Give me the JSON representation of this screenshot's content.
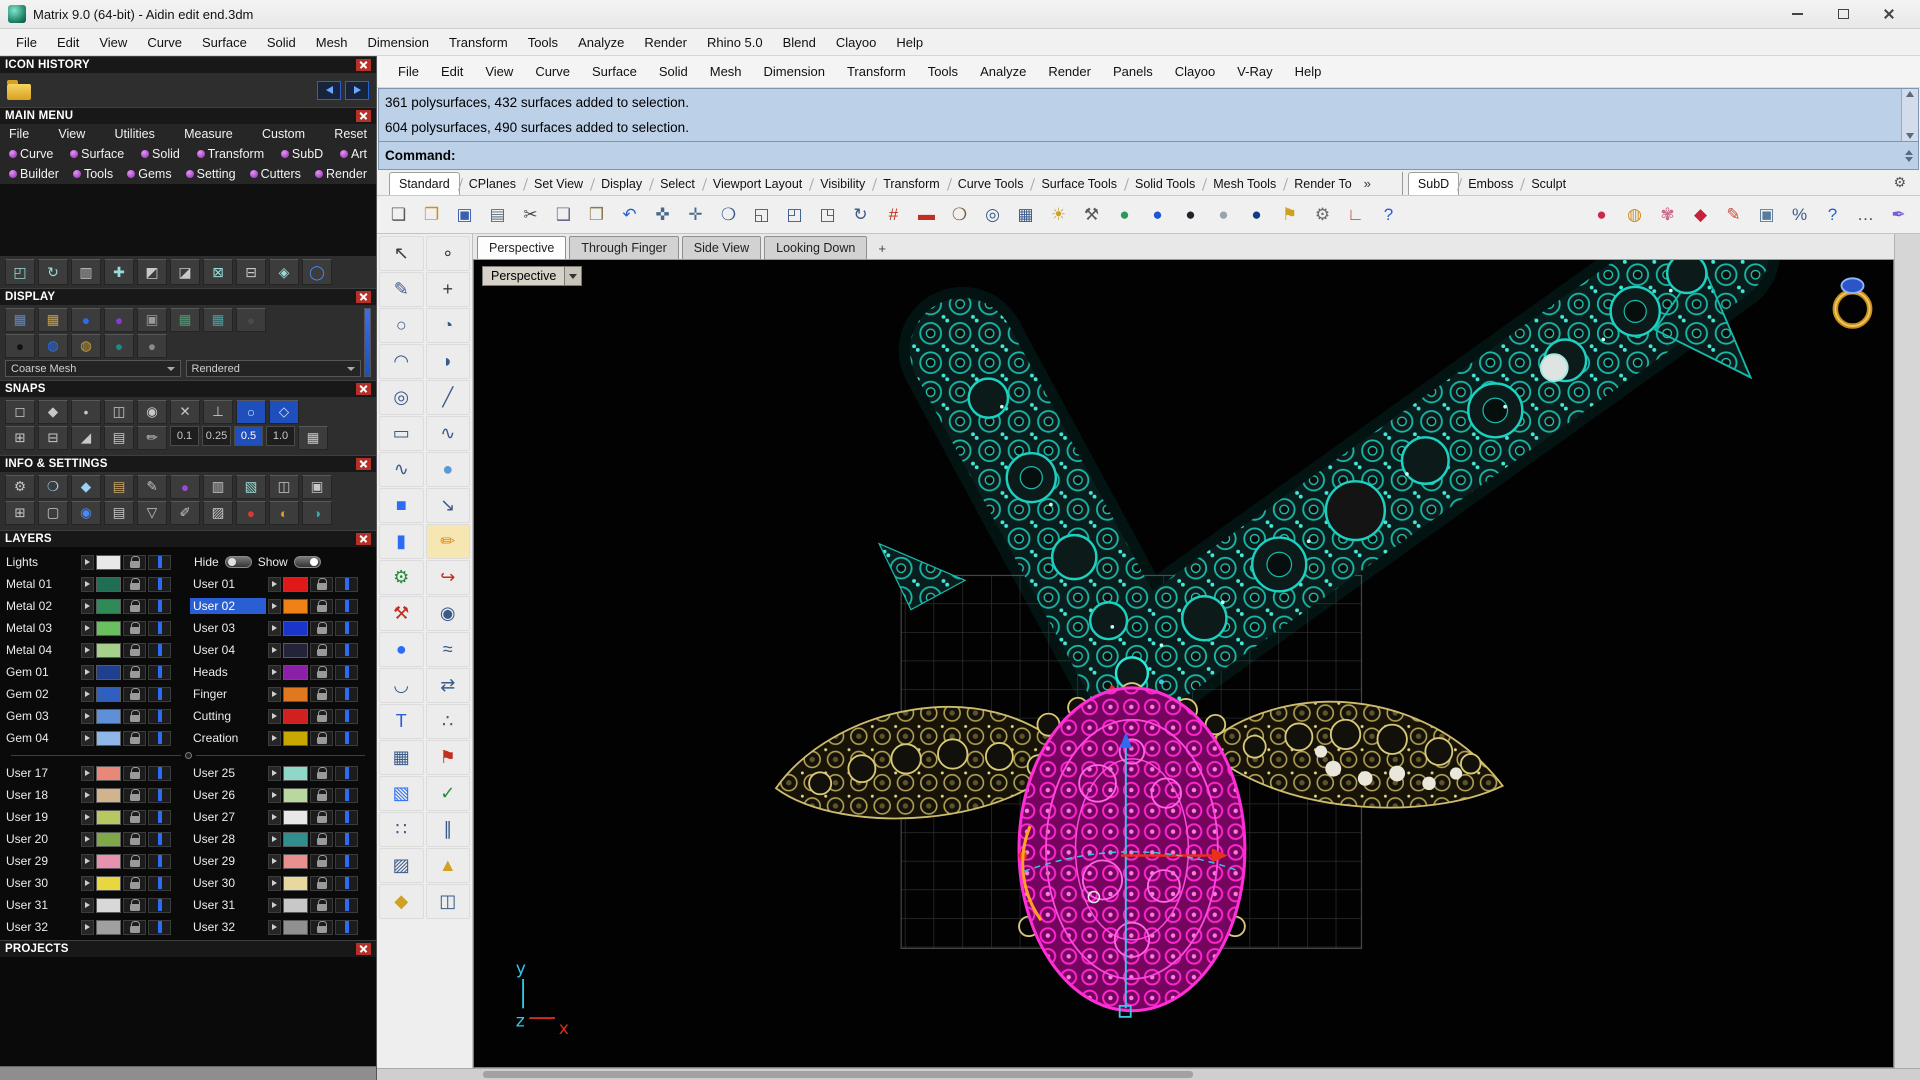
{
  "window": {
    "title": "Matrix 9.0 (64-bit) - Aidin edit end.3dm"
  },
  "app_menu": {
    "items": [
      "File",
      "Edit",
      "View",
      "Curve",
      "Surface",
      "Solid",
      "Mesh",
      "Dimension",
      "Transform",
      "Tools",
      "Analyze",
      "Render",
      "Rhino 5.0",
      "Blend",
      "Clayoo",
      "Help"
    ]
  },
  "sidebar": {
    "icon_history": {
      "title": "ICON HISTORY"
    },
    "main_menu": {
      "title": "MAIN MENU",
      "row1": [
        "File",
        "View",
        "Utilities",
        "Measure",
        "Custom",
        "Reset"
      ],
      "row2": [
        "Curve",
        "Surface",
        "Solid",
        "Transform",
        "SubD",
        "Art"
      ],
      "row3": [
        "Builder",
        "Tools",
        "Gems",
        "Setting",
        "Cutters",
        "Render"
      ]
    },
    "transform_row": {
      "icons": [
        {
          "n": "gumball-icon",
          "g": "◰",
          "c": "#9adcd8"
        },
        {
          "n": "rotate-icon",
          "g": "↻",
          "c": "#9adcd8"
        },
        {
          "n": "columns-icon",
          "g": "▥",
          "c": "#c8c8c8"
        },
        {
          "n": "move-icon",
          "g": "✚",
          "c": "#9adcd8"
        },
        {
          "n": "align-icon",
          "g": "◩",
          "c": "#c8c8c8"
        },
        {
          "n": "orient-icon",
          "g": "◪",
          "c": "#c8c8c8"
        },
        {
          "n": "boolean-icon",
          "g": "⊠",
          "c": "#9adcd8"
        },
        {
          "n": "split-icon",
          "g": "⊟",
          "c": "#c8c8c8"
        },
        {
          "n": "merge-icon",
          "g": "◈",
          "c": "#9adcd8"
        },
        {
          "n": "blue-ring-icon",
          "g": "◯",
          "c": "#4a8af4"
        }
      ]
    },
    "display": {
      "title": "DISPLAY",
      "mesh_dropdown": "Coarse Mesh",
      "mode_dropdown": "Rendered",
      "icons1": [
        {
          "n": "wireframe-mode-icon",
          "g": "▦",
          "c": "#5a8ad4"
        },
        {
          "n": "shaded-mode-icon",
          "g": "▦",
          "c": "#d0a030"
        },
        {
          "n": "rendered-mode-icon",
          "g": "●",
          "c": "#2a6df4"
        },
        {
          "n": "raytraced-mode-icon",
          "g": "●",
          "c": "#8a3ad4"
        },
        {
          "n": "monitor-mode-icon",
          "g": "▣",
          "c": "#9a9a9a"
        },
        {
          "n": "grid-green-icon",
          "g": "▦",
          "c": "#3aa86a"
        },
        {
          "n": "grid-teal-icon",
          "g": "▦",
          "c": "#3aa8a8"
        },
        {
          "n": "dark-mode-icon",
          "g": "●",
          "c": "#4a4a4a"
        }
      ],
      "icons2": [
        {
          "n": "black-sphere-icon",
          "g": "●",
          "c": "#111111"
        },
        {
          "n": "ring-blue-icon",
          "g": "◍",
          "c": "#2a6df4"
        },
        {
          "n": "ring-gold-icon",
          "g": "◍",
          "c": "#d0a030"
        },
        {
          "n": "sphere-teal-icon",
          "g": "●",
          "c": "#1a8a8a"
        },
        {
          "n": "sphere-gray-icon",
          "g": "●",
          "c": "#8a8a8a"
        }
      ]
    },
    "snaps": {
      "title": "SNAPS",
      "icons1": [
        {
          "n": "snap-end-icon",
          "g": "◻",
          "c": "#c8c8c8"
        },
        {
          "n": "snap-near-icon",
          "g": "◆",
          "c": "#c8c8c8"
        },
        {
          "n": "snap-point-icon",
          "g": "•",
          "c": "#c8c8c8"
        },
        {
          "n": "snap-mid-icon",
          "g": "◫",
          "c": "#c8c8c8"
        },
        {
          "n": "snap-cen-icon",
          "g": "◉",
          "c": "#c8c8c8"
        },
        {
          "n": "snap-int-icon",
          "g": "✕",
          "c": "#c8c8c8"
        },
        {
          "n": "snap-perp-icon",
          "g": "⊥",
          "c": "#c8c8c8"
        },
        {
          "n": "snap-tan-icon",
          "g": "○",
          "c": "#cfe4ff",
          "b": "#1e4fbc"
        },
        {
          "n": "snap-quad-icon",
          "g": "◇",
          "c": "#cfe4ff",
          "b": "#1e4fbc"
        }
      ],
      "icons2": [
        {
          "n": "grid-snap-toggle-icon",
          "g": "⊞",
          "c": "#c8c8c8"
        },
        {
          "n": "ortho-toggle-icon",
          "g": "⊟",
          "c": "#c8c8c8"
        },
        {
          "n": "planar-toggle-icon",
          "g": "◢",
          "c": "#c8c8c8"
        },
        {
          "n": "osnap-panel-icon",
          "g": "▤",
          "c": "#c8c8c8"
        },
        {
          "n": "smarttrack-icon",
          "g": "✏",
          "c": "#c8c8c8"
        }
      ],
      "increments": [
        {
          "v": "0.1"
        },
        {
          "v": "0.25"
        },
        {
          "v": "0.5",
          "bg": "#1e4fbc",
          "fg": "#ffffff"
        },
        {
          "v": "1.0"
        }
      ],
      "trailing_icon": {
        "g": "▦"
      }
    },
    "info_settings": {
      "title": "INFO & SETTINGS",
      "icons1": [
        {
          "n": "gear-icon",
          "g": "⚙",
          "c": "#c8c8c8"
        },
        {
          "n": "search-icon",
          "g": "❍",
          "c": "#9ad4f4"
        },
        {
          "n": "gem-info-icon",
          "g": "◆",
          "c": "#9ad4f4"
        },
        {
          "n": "notebook-icon",
          "g": "▤",
          "c": "#c8a868"
        },
        {
          "n": "edit-pen-icon",
          "g": "✎",
          "c": "#c8c8c8"
        },
        {
          "n": "purple-ball-icon",
          "g": "●",
          "c": "#9a4ad4"
        },
        {
          "n": "rows-info-icon",
          "g": "▥",
          "c": "#c8c8c8"
        },
        {
          "n": "texture-icon",
          "g": "▧",
          "c": "#9adcd8"
        },
        {
          "n": "columns-info-icon",
          "g": "◫",
          "c": "#c8c8c8"
        },
        {
          "n": "panel-info-icon",
          "g": "▣",
          "c": "#c8c8c8"
        }
      ],
      "icons2": [
        {
          "n": "table-icon",
          "g": "⊞",
          "c": "#c8c8c8"
        },
        {
          "n": "screen-icon",
          "g": "▢",
          "c": "#c8c8c8"
        },
        {
          "n": "globe-icon",
          "g": "◉",
          "c": "#4a8af4"
        },
        {
          "n": "document-icon",
          "g": "▤",
          "c": "#c8c8c8"
        },
        {
          "n": "funnel-icon",
          "g": "▽",
          "c": "#c8c8c8"
        },
        {
          "n": "annotate-icon",
          "g": "✐",
          "c": "#c8c8c8"
        },
        {
          "n": "hatch-info-icon",
          "g": "▨",
          "c": "#c8c8c8"
        },
        {
          "n": "red-ball-icon",
          "g": "●",
          "c": "#d43a3a"
        },
        {
          "n": "half-gold-icon",
          "g": "◐",
          "c": "#d0a030"
        },
        {
          "n": "half-teal-icon",
          "g": "◑",
          "c": "#3aa8a8"
        }
      ]
    },
    "layers": {
      "title": "LAYERS",
      "lights": {
        "name": "Lights",
        "hide_label": "Hide",
        "show_label": "Show",
        "swatch": "#e8e8e8"
      },
      "rows": [
        {
          "left": {
            "name": "Metal 01",
            "color": "#1f6e54"
          },
          "right": {
            "name": "User 01",
            "color": "#e01818"
          }
        },
        {
          "left": {
            "name": "Metal 02",
            "color": "#2e8b57"
          },
          "right": {
            "name": "User 02",
            "color": "#f08018",
            "bg": "#2a5fd4",
            "fg": "#ffffff"
          }
        },
        {
          "left": {
            "name": "Metal 03",
            "color": "#6abf5e"
          },
          "right": {
            "name": "User 03",
            "color": "#1a35cc"
          }
        },
        {
          "left": {
            "name": "Metal 04",
            "color": "#a8d08d"
          },
          "right": {
            "name": "User 04",
            "color": "#23233a"
          }
        },
        {
          "left": {
            "name": "Gem 01",
            "color": "#1f3f8f"
          },
          "right": {
            "name": "Heads",
            "color": "#8b1fa8"
          }
        },
        {
          "left": {
            "name": "Gem 02",
            "color": "#2f5fbf"
          },
          "right": {
            "name": "Finger",
            "color": "#e07820"
          }
        },
        {
          "left": {
            "name": "Gem 03",
            "color": "#5f8fd8"
          },
          "right": {
            "name": "Cutting",
            "color": "#d02020"
          }
        },
        {
          "left": {
            "name": "Gem 04",
            "color": "#8fb8e8"
          },
          "right": {
            "name": "Creation",
            "color": "#c8a800"
          }
        }
      ],
      "rows2": [
        {
          "left": {
            "name": "User 17",
            "color": "#e88878"
          },
          "right": {
            "name": "User 25",
            "color": "#8fd8c8"
          }
        },
        {
          "left": {
            "name": "User 18",
            "color": "#d2b48c"
          },
          "right": {
            "name": "User 26",
            "color": "#b8d8a0"
          }
        },
        {
          "left": {
            "name": "User 19",
            "color": "#b8c860"
          },
          "right": {
            "name": "User 27",
            "color": "#e8e8e8"
          }
        },
        {
          "left": {
            "name": "User 20",
            "color": "#7fa848"
          },
          "right": {
            "name": "User 28",
            "color": "#2f8f8f"
          }
        }
      ],
      "rows3": [
        {
          "left": {
            "name": "User 29",
            "color": "#e890b0"
          },
          "right": {
            "name": "User 29",
            "color": "#e89090"
          }
        },
        {
          "left": {
            "name": "User 30",
            "color": "#e8d840"
          },
          "right": {
            "name": "User 30",
            "color": "#e8d8a0"
          }
        },
        {
          "left": {
            "name": "User 31",
            "color": "#d8d8d8"
          },
          "right": {
            "name": "User 31",
            "color": "#c8c8c8"
          }
        },
        {
          "left": {
            "name": "User 32",
            "color": "#a0a0a0"
          },
          "right": {
            "name": "User 32",
            "color": "#909090"
          }
        }
      ]
    },
    "projects": {
      "title": "PROJECTS"
    }
  },
  "rhino": {
    "menu": [
      "File",
      "Edit",
      "View",
      "Curve",
      "Surface",
      "Solid",
      "Mesh",
      "Dimension",
      "Transform",
      "Tools",
      "Analyze",
      "Render",
      "Panels",
      "Clayoo",
      "V-Ray",
      "Help"
    ],
    "history_lines": [
      "361 polysurfaces, 432 surfaces added to selection.",
      "604 polysurfaces, 490 surfaces added to selection."
    ],
    "prompt": "Command:",
    "tabs": [
      "Standard",
      "CPlanes",
      "Set View",
      "Display",
      "Select",
      "Viewport Layout",
      "Visibility",
      "Transform",
      "Curve Tools",
      "Surface Tools",
      "Solid Tools",
      "Mesh Tools",
      "Render To"
    ],
    "overflow": "»",
    "side_tabs": [
      "SubD",
      "Emboss",
      "Sculpt"
    ],
    "tab_gear": "⚙",
    "viewport_tabs": [
      "Perspective",
      "Through Finger",
      "Side View",
      "Looking Down"
    ],
    "new_viewport": "+",
    "viewport_label": "Perspective",
    "toolbar": {
      "main": [
        {
          "n": "new-file-icon",
          "g": "❏",
          "c": "#5a5a5a"
        },
        {
          "n": "open-file-icon",
          "g": "❐",
          "c": "#d09020"
        },
        {
          "n": "save-file-icon",
          "g": "▣",
          "c": "#3a5fae"
        },
        {
          "n": "print-icon",
          "g": "▤",
          "c": "#5a6a7a"
        },
        {
          "n": "cut-icon",
          "g": "✂",
          "c": "#4a4a4a"
        },
        {
          "n": "copy-icon",
          "g": "❑",
          "c": "#6a6a8a"
        },
        {
          "n": "paste-icon",
          "g": "❒",
          "c": "#8a7a4a"
        },
        {
          "n": "undo-icon",
          "g": "↶",
          "c": "#2a5fd4"
        },
        {
          "n": "pan-hand-icon",
          "g": "✜",
          "c": "#4a6a8a"
        },
        {
          "n": "move-view-icon",
          "g": "✛",
          "c": "#4a6a8a"
        },
        {
          "n": "zoom-dynamic-icon",
          "g": "❍",
          "c": "#3a5a8a"
        },
        {
          "n": "zoom-window-icon",
          "g": "◱",
          "c": "#3a5a8a"
        },
        {
          "n": "zoom-extents-icon",
          "g": "◰",
          "c": "#3a5a8a"
        },
        {
          "n": "zoom-selected-icon",
          "g": "◳",
          "c": "#3a5a8a"
        },
        {
          "n": "rotate-view-icon",
          "g": "↻",
          "c": "#3a5a8a"
        },
        {
          "n": "grid-snap-icon",
          "g": "#",
          "c": "#c03020"
        },
        {
          "n": "car-display-icon",
          "g": "▬",
          "c": "#c03020"
        },
        {
          "n": "zoom-lens-icon",
          "g": "❍",
          "c": "#7a5a3a"
        },
        {
          "n": "center-mark-icon",
          "g": "◎",
          "c": "#3a5a8a"
        },
        {
          "n": "grid-table-icon",
          "g": "▦",
          "c": "#3a5a8a"
        },
        {
          "n": "light-tool-icon",
          "g": "☀",
          "c": "#d0a020"
        },
        {
          "n": "weight-tool-icon",
          "g": "⚒",
          "c": "#5a5a5a"
        },
        {
          "n": "material-drop-icon",
          "g": "●",
          "c": "#2a9a5a"
        },
        {
          "n": "sphere-blue-icon",
          "g": "●",
          "c": "#1a56d6"
        },
        {
          "n": "sphere-dark-icon",
          "g": "●",
          "c": "#20242a"
        },
        {
          "n": "sphere-gray-icon",
          "g": "●",
          "c": "#9aa2aa"
        },
        {
          "n": "sphere-navy-icon",
          "g": "●",
          "c": "#123a8a"
        },
        {
          "n": "flag-marker-icon",
          "g": "⚑",
          "c": "#d0a020"
        },
        {
          "n": "gear-settings-icon",
          "g": "⚙",
          "c": "#6a6a6a"
        },
        {
          "n": "cplane-axes-icon",
          "g": "∟",
          "c": "#c04040"
        },
        {
          "n": "help-icon",
          "g": "?",
          "c": "#2a5fd4"
        }
      ],
      "right": [
        {
          "n": "bead-red-icon",
          "g": "●",
          "c": "#c82a4a"
        },
        {
          "n": "ring-builder-icon",
          "g": "◍",
          "c": "#d09020"
        },
        {
          "n": "gem-swirl-icon",
          "g": "✾",
          "c": "#c86a8a"
        },
        {
          "n": "gem-red-icon",
          "g": "◆",
          "c": "#c8203a"
        },
        {
          "n": "profile-pen-icon",
          "g": "✎",
          "c": "#c84a3a"
        },
        {
          "n": "render-frame-icon",
          "g": "▣",
          "c": "#5a7a9a"
        },
        {
          "n": "percent-tool-icon",
          "g": "%",
          "c": "#3a5a8a"
        },
        {
          "n": "help-round-icon",
          "g": "?",
          "c": "#2a5fd4"
        },
        {
          "n": "more-options-icon",
          "g": "…",
          "c": "#4a4a4a"
        },
        {
          "n": "vray-pen-icon",
          "g": "✒",
          "c": "#7a5fd0"
        }
      ]
    }
  },
  "palette": {
    "col1": [
      {
        "n": "select-arrow-icon",
        "g": "↖",
        "c": "#3a3a3a"
      },
      {
        "n": "curve-pen-icon",
        "g": "✎",
        "c": "#3a5a8a"
      },
      {
        "n": "circle-icon",
        "g": "○",
        "c": "#3a5a8a"
      },
      {
        "n": "arc-icon",
        "g": "◠",
        "c": "#3a5a8a"
      },
      {
        "n": "ellipse-icon",
        "g": "◎",
        "c": "#3a5a8a"
      },
      {
        "n": "rectangle-icon",
        "g": "▭",
        "c": "#3a5a8a"
      },
      {
        "n": "freeform-curve-icon",
        "g": "∿",
        "c": "#3a5a8a"
      },
      {
        "n": "box-icon",
        "g": "■",
        "c": "#2a6df4"
      },
      {
        "n": "cylinder-icon",
        "g": "▮",
        "c": "#2a6df4"
      },
      {
        "n": "gear-solid-icon",
        "g": "⚙",
        "c": "#2a8a3a"
      },
      {
        "n": "hammer-icon",
        "g": "⚒",
        "c": "#c03020"
      },
      {
        "n": "sphere-icon",
        "g": "●",
        "c": "#2a6df4"
      },
      {
        "n": "arc-blend-icon",
        "g": "◡",
        "c": "#3a5a8a"
      },
      {
        "n": "text-icon",
        "g": "T",
        "c": "#2a5fd4"
      },
      {
        "n": "array-icon",
        "g": "▦",
        "c": "#3a5a8a"
      },
      {
        "n": "surface-icon",
        "g": "▧",
        "c": "#2a6df4"
      },
      {
        "n": "points-icon",
        "g": "∷",
        "c": "#3a5a8a"
      },
      {
        "n": "hatch-icon",
        "g": "▨",
        "c": "#3a5a8a"
      },
      {
        "n": "solid-gold-icon",
        "g": "◆",
        "c": "#d0a020"
      }
    ],
    "col2": [
      {
        "n": "point-icon",
        "g": "∘",
        "c": "#3a3a3a"
      },
      {
        "n": "crosshair-icon",
        "g": "+",
        "c": "#3a3a3a"
      },
      {
        "n": "compass-icon",
        "g": "◔",
        "c": "#3a5a8a"
      },
      {
        "n": "protractor-icon",
        "g": "◗",
        "c": "#3a5a8a"
      },
      {
        "n": "line-icon",
        "g": "╱",
        "c": "#3a5a8a"
      },
      {
        "n": "wave-curve-icon",
        "g": "∿",
        "c": "#3a5a8a"
      },
      {
        "n": "small-sphere-icon",
        "g": "●",
        "c": "#5a9ad4"
      },
      {
        "n": "scale-icon",
        "g": "↘",
        "c": "#3a5a8a"
      },
      {
        "n": "pencil-icon",
        "g": "✏",
        "c": "#e08818",
        "b": "#f6e6b2"
      },
      {
        "n": "hook-icon",
        "g": "↪",
        "c": "#c03020"
      },
      {
        "n": "target-icon",
        "g": "◉",
        "c": "#3a5a8a"
      },
      {
        "n": "approx-icon",
        "g": "≈",
        "c": "#3a5a8a"
      },
      {
        "n": "swap-icon",
        "g": "⇄",
        "c": "#3a5a8a"
      },
      {
        "n": "dots-icon",
        "g": "∴",
        "c": "#3a5a8a"
      },
      {
        "n": "flag-icon",
        "g": "⚑",
        "c": "#c03020"
      },
      {
        "n": "check-icon",
        "g": "✓",
        "c": "#2a8a3a"
      },
      {
        "n": "parallel-icon",
        "g": "∥",
        "c": "#3a5a8a"
      },
      {
        "n": "cone-icon",
        "g": "▲",
        "c": "#d0a020"
      },
      {
        "n": "mirror-icon",
        "g": "◫",
        "c": "#3a5a8a"
      }
    ]
  }
}
